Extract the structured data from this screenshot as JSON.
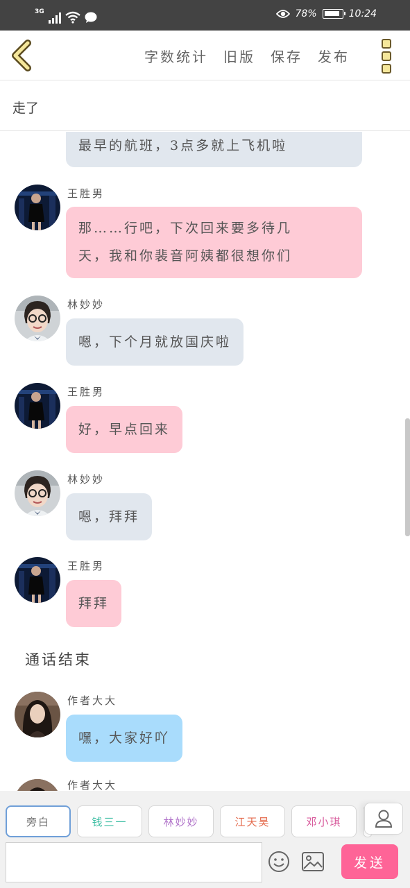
{
  "status_bar": {
    "network": "3G",
    "battery": "78%",
    "time": "10:24",
    "icons": [
      "signal-icon",
      "wifi-icon",
      "message-icon",
      "eye-icon",
      "battery-icon"
    ]
  },
  "toolbar": {
    "back_icon": "chevron-left-icon",
    "word_count": "字数统计",
    "old_version": "旧版",
    "save": "保存",
    "publish": "发布",
    "more_icon": "more-vertical-icon",
    "accent": "#f5e79b"
  },
  "title": "走了",
  "messages": [
    {
      "type": "message",
      "sender": "",
      "text": "最早的航班，3点多就上飞机啦",
      "style": "gray"
    },
    {
      "type": "message",
      "sender": "王胜男",
      "text_lines": [
        "那……行吧，下次回来要多待几",
        "天，我和你裴音阿姨都很想你们"
      ],
      "style": "pink"
    },
    {
      "type": "message",
      "sender": "林妙妙",
      "text": "嗯，下个月就放国庆啦",
      "style": "gray"
    },
    {
      "type": "message",
      "sender": "王胜男",
      "text": "好，早点回来",
      "style": "pink"
    },
    {
      "type": "message",
      "sender": "林妙妙",
      "text": "嗯，拜拜",
      "style": "gray"
    },
    {
      "type": "message",
      "sender": "王胜男",
      "text": "拜拜",
      "style": "pink"
    },
    {
      "type": "narration",
      "text": "通话结束"
    },
    {
      "type": "message",
      "sender": "作者大大",
      "text": "嘿，大家好吖",
      "style": "blue"
    },
    {
      "type": "message",
      "sender": "作者大大",
      "text": "",
      "style": "blue"
    }
  ],
  "colors": {
    "bubble_gray": "#e1e7ee",
    "bubble_pink": "#fecbd6",
    "bubble_blue": "#a9dcfc",
    "send_button": "#fe6497"
  },
  "characters": [
    {
      "name": "旁白",
      "color": "#777777",
      "selected": true
    },
    {
      "name": "钱三一",
      "color": "#3fbfa4"
    },
    {
      "name": "林妙妙",
      "color": "#b072c9"
    },
    {
      "name": "江天昊",
      "color": "#e46a4c"
    },
    {
      "name": "邓小琪",
      "color": "#d85a9c"
    }
  ],
  "composer": {
    "placeholder": "",
    "emoji_icon": "smiley-icon",
    "image_icon": "image-icon",
    "person_icon": "person-icon",
    "send": "发送"
  }
}
